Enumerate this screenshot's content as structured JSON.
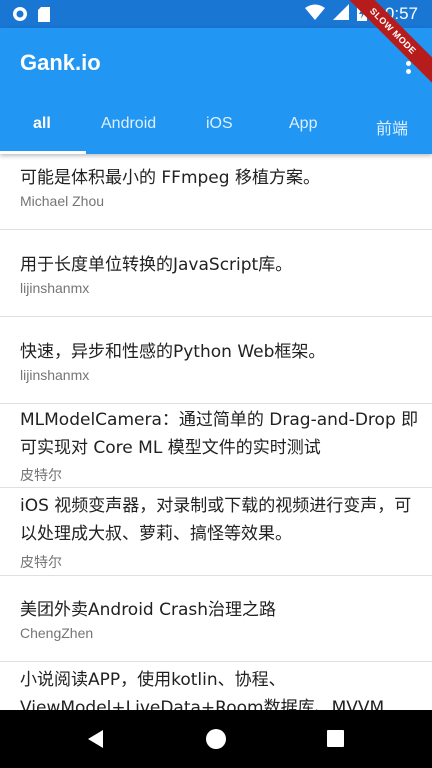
{
  "status_bar": {
    "time": "10:57",
    "icons": [
      "circle-notification-icon",
      "sd-card-icon",
      "wifi-icon",
      "signal-icon",
      "battery-charging-icon"
    ]
  },
  "app_bar": {
    "title": "Gank.io",
    "overflow_icon": "more-vert-icon",
    "color": "#2196f3"
  },
  "debug_banner": "SLOW MODE",
  "tabs": [
    {
      "label": "all"
    },
    {
      "label": "Android"
    },
    {
      "label": "iOS"
    },
    {
      "label": "App"
    },
    {
      "label": "前端"
    }
  ],
  "articles": [
    {
      "title": "可能是体积最小的 FFmpeg 移植方案。",
      "author": "Michael Zhou"
    },
    {
      "title": "用于长度单位转换的JavaScript库。",
      "author": "lijinshanmx"
    },
    {
      "title": "快速，异步和性感的Python Web框架。",
      "author": "lijinshanmx"
    },
    {
      "title": "MLModelCamera：通过简单的 Drag-and-Drop 即可实现对 Core ML 模型文件的实时测试",
      "author": "皮特尔"
    },
    {
      "title": "iOS 视频变声器，对录制或下载的视频进行变声，可以处理成大叔、萝莉、搞怪等效果。",
      "author": "皮特尔"
    },
    {
      "title": "美团外卖Android Crash治理之路",
      "author": "ChengZhen"
    },
    {
      "title": "小说阅读APP，使用kotlin、协程、ViewModel+LiveData+Room数据库、MVVM",
      "author": ""
    }
  ],
  "nav_bar": {
    "back_icon": "back-icon",
    "home_icon": "home-icon",
    "recents_icon": "recents-icon"
  }
}
